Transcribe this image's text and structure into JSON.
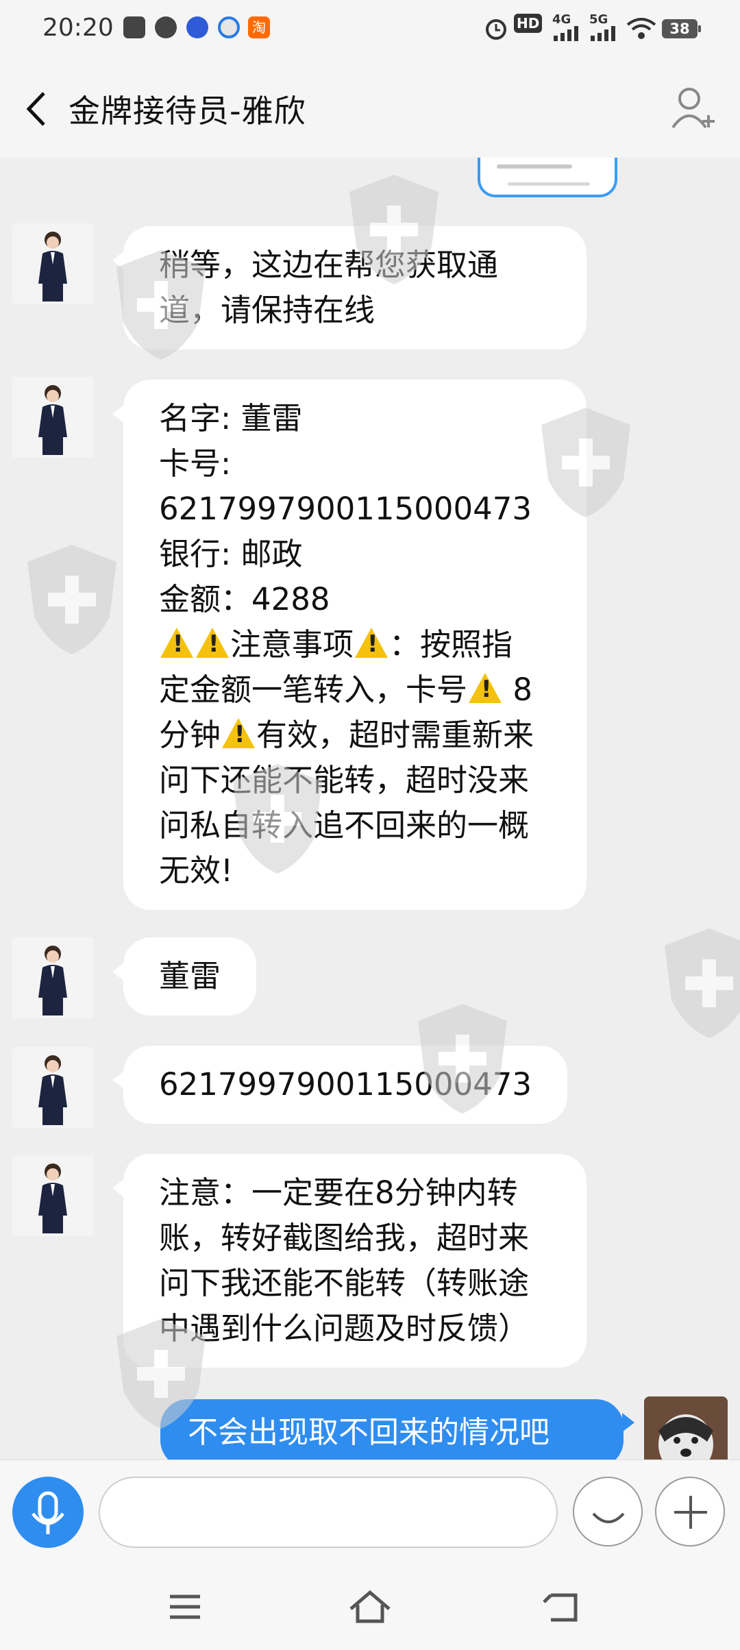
{
  "status": {
    "time": "20:20",
    "hd": "HD",
    "net1": "4G",
    "net2": "5G",
    "battery": "38"
  },
  "header": {
    "title": "金牌接待员-雅欣"
  },
  "messages": [
    {
      "lines": [
        "稍等，这边在帮您获取通",
        "道，请保持在线"
      ]
    },
    {
      "lines": [
        "名字:   董雷",
        "卡号:",
        "6217997900115000473",
        "银行:   邮政",
        "金额：4288"
      ],
      "warn_line_1": {
        "pre": "",
        "mid": "注意事项",
        "post": "：按照指"
      },
      "warn_line_2": {
        "pre": "定金额一笔转入，卡号",
        "post": " 8"
      },
      "warn_line_3": {
        "pre": "分钟",
        "post": "有效，超时需重新来"
      },
      "tail_lines": [
        "问下还能不能转，超时没来",
        "问私自转入追不回来的一概",
        "无效!"
      ]
    },
    {
      "lines": [
        "董雷"
      ]
    },
    {
      "lines": [
        "6217997900115000473"
      ]
    },
    {
      "lines": [
        "注意：一定要在8分钟内转",
        "账，转好截图给我，超时来",
        "问下我还能不能转（转账途",
        "中遇到什么问题及时反馈）"
      ]
    }
  ],
  "outgoing": {
    "text": "不会出现取不回来的情况吧"
  },
  "input": {
    "placeholder": ""
  }
}
